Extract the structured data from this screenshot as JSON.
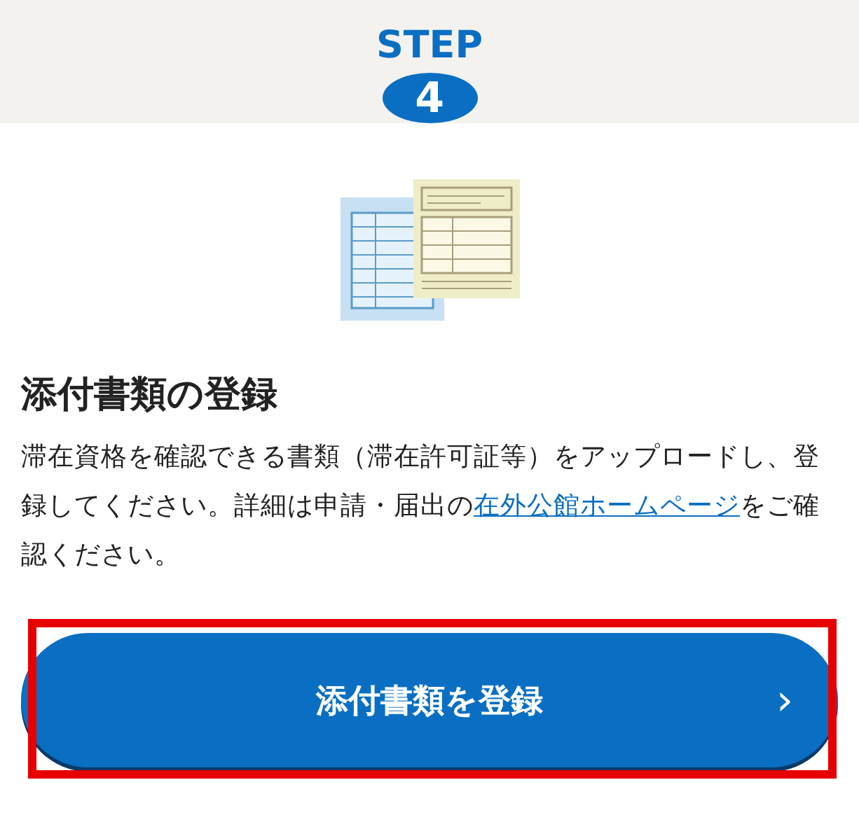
{
  "step": {
    "label": "STEP",
    "number": "4"
  },
  "section": {
    "heading": "添付書類の登録",
    "text_before": "滞在資格を確認できる書類（滞在許可証等）をアップロードし、登録してください。詳細は申請・届出の",
    "link": "在外公館ホームページ",
    "text_after": "をご確認ください。"
  },
  "button": {
    "label": "添付書類を登録",
    "chevron": "›",
    "highlighted": true
  }
}
